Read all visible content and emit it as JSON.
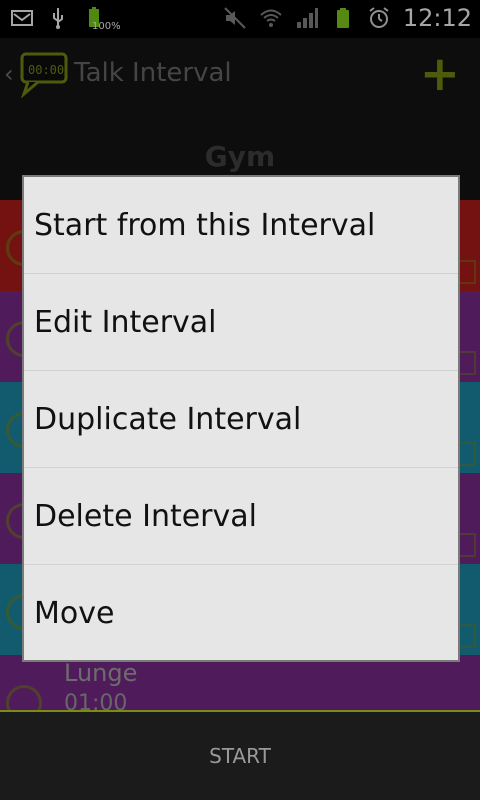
{
  "status_bar": {
    "battery_percent_label": "100%",
    "clock": "12:12",
    "icons": [
      "notification-icon",
      "usb-icon",
      "battery-icon",
      "mute-icon",
      "wifi-icon",
      "signal-icon",
      "battery-full-icon",
      "alarm-icon"
    ]
  },
  "action_bar": {
    "title": "Talk Interval",
    "add_label": "+"
  },
  "workout": {
    "name": "Gym"
  },
  "intervals": [
    {
      "color": "#b21d1d",
      "label": "",
      "time": ""
    },
    {
      "color": "#7b2a8c",
      "label": "",
      "time": ""
    },
    {
      "color": "#1c8aa8",
      "label": "",
      "time": ""
    },
    {
      "color": "#7b2a8c",
      "label": "",
      "time": ""
    },
    {
      "color": "#1c8aa8",
      "label": "",
      "time": ""
    },
    {
      "color": "#7b2a8c",
      "label": "Lunge",
      "time": "01:00"
    }
  ],
  "context_menu": {
    "items": [
      "Start from this Interval",
      "Edit Interval",
      "Duplicate Interval",
      "Delete Interval",
      "Move"
    ]
  },
  "bottom_bar": {
    "start_label": "START"
  },
  "colors": {
    "accent": "#7a8c13",
    "menu_bg": "#e6e6e6"
  }
}
